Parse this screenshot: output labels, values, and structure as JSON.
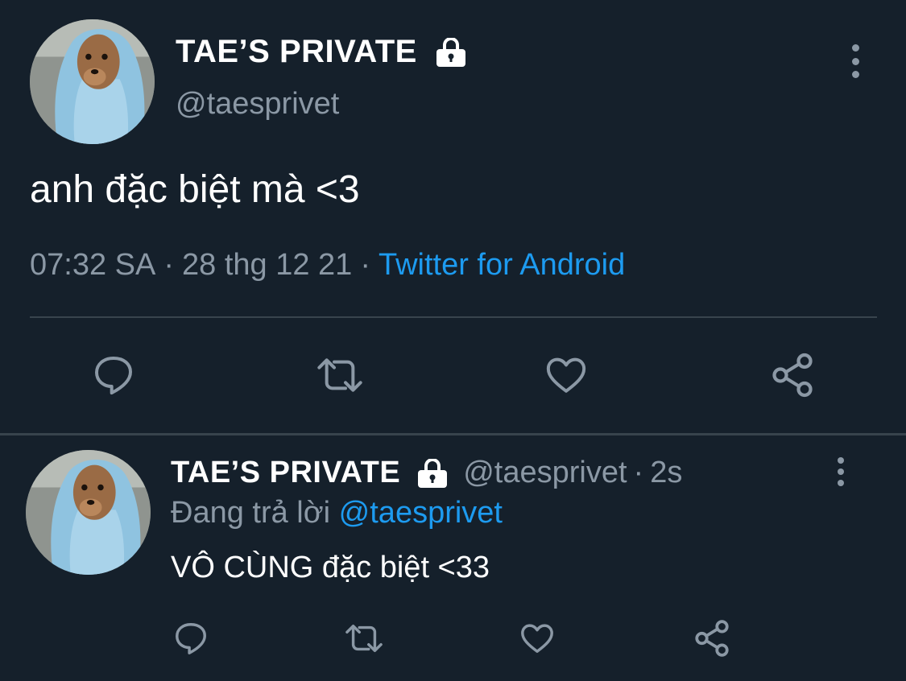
{
  "main_tweet": {
    "display_name": "TAE’S PRIVATE",
    "handle": "@taesprivet",
    "text": "anh đặc biệt mà <3",
    "time": "07:32 SA",
    "date": "28 thg 12 21",
    "separator": "·",
    "source": "Twitter for Android",
    "icons": [
      "lock-icon",
      "more-icon",
      "reply-icon",
      "retweet-icon",
      "like-icon",
      "share-icon"
    ]
  },
  "reply_tweet": {
    "display_name": "TAE’S PRIVATE",
    "handle": "@taesprivet",
    "separator": "·",
    "time_ago": "2s",
    "replying_prefix": "Đang trả lời",
    "replying_to": "@taesprivet",
    "text": "VÔ CÙNG đặc biệt <33",
    "icons": [
      "lock-icon",
      "more-icon",
      "reply-icon",
      "retweet-icon",
      "like-icon",
      "share-icon"
    ]
  },
  "colors": {
    "background": "#15202b",
    "primary_text": "#ffffff",
    "secondary_text": "#8b98a5",
    "accent": "#1d9bf0",
    "divider": "#38444d"
  }
}
